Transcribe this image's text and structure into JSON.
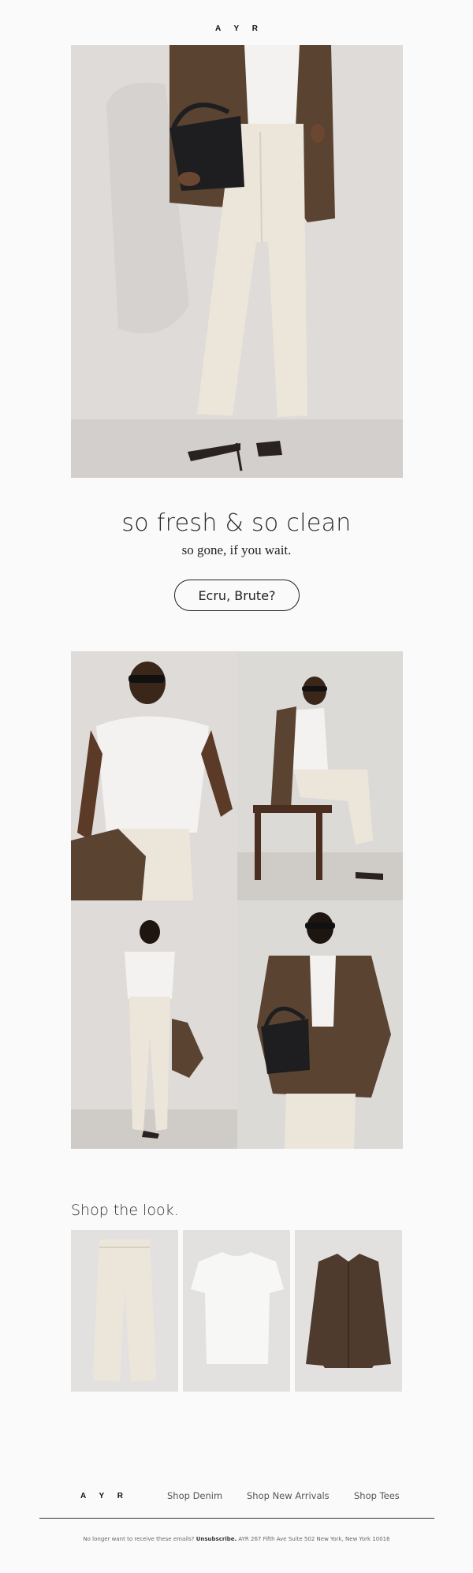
{
  "header": {
    "logo": "A Y R"
  },
  "hero": {
    "headline": "so fresh & so clean",
    "subheadline": "so gone, if you wait.",
    "cta_label": "Ecru, Brute?"
  },
  "shop": {
    "title": "Shop the look.",
    "products": [
      {
        "icon": "ecru-jeans-product"
      },
      {
        "icon": "white-tee-product"
      },
      {
        "icon": "brown-suede-jacket-product"
      }
    ]
  },
  "footer": {
    "logo": "A Y R",
    "links": [
      "Shop Denim",
      "Shop New Arrivals",
      "Shop Tees"
    ],
    "legal_prefix": "No longer want to receive these emails?",
    "unsubscribe_label": "Unsubscribe.",
    "address": "AYR 267 Fifth Ave Suite 502 New York, New York 10016"
  },
  "colors": {
    "background": "#fbfafa",
    "photo_wall": "#dcdad7",
    "ecru": "#ece6da",
    "suede_brown": "#5a4331",
    "text": "#222222"
  }
}
